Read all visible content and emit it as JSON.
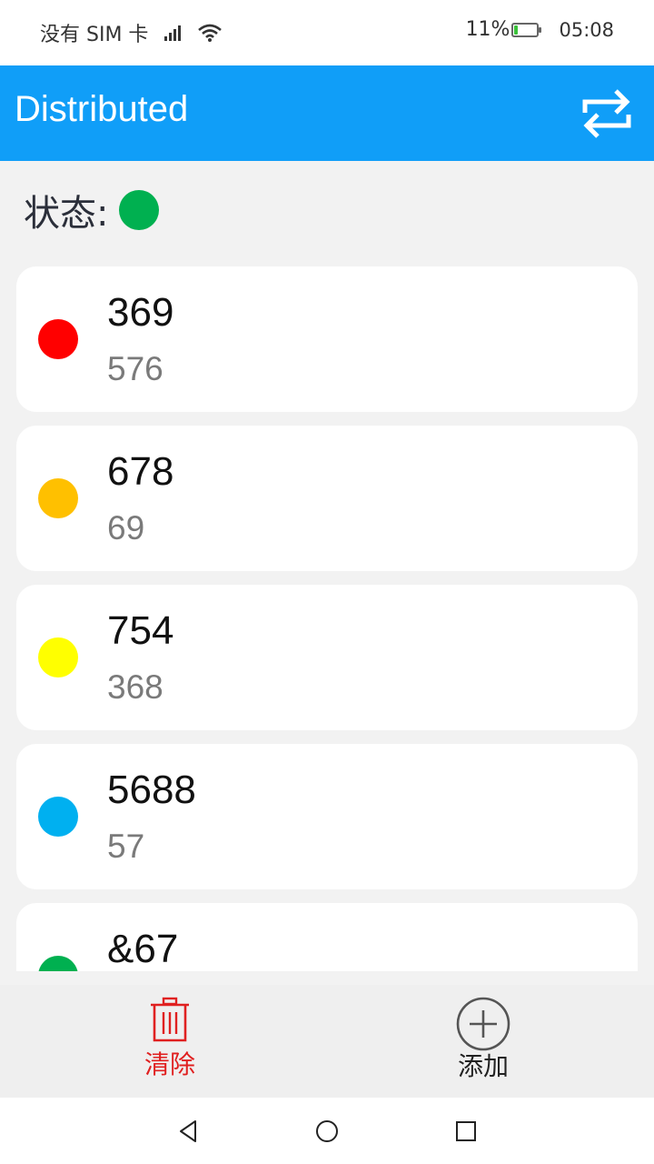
{
  "status_bar": {
    "carrier": "没有 SIM 卡",
    "battery": "11%",
    "time": "05:08",
    "battery_level": 0.11
  },
  "app_bar": {
    "title": "Distributed",
    "switch_icon": "swap-arrows-icon"
  },
  "state": {
    "label": "状态:",
    "color": "#00b050"
  },
  "items": [
    {
      "title": "369",
      "subtitle": "576",
      "color": "#ff0000"
    },
    {
      "title": "678",
      "subtitle": "69",
      "color": "#ffc000"
    },
    {
      "title": "754",
      "subtitle": "368",
      "color": "#ffff00"
    },
    {
      "title": "5688",
      "subtitle": "57",
      "color": "#00b0f0"
    },
    {
      "title": "&67",
      "subtitle": "",
      "color": "#00b050"
    }
  ],
  "actions": {
    "clear_label": "清除",
    "add_label": "添加",
    "clear_color": "#e02020"
  },
  "accent_color": "#109ef8"
}
